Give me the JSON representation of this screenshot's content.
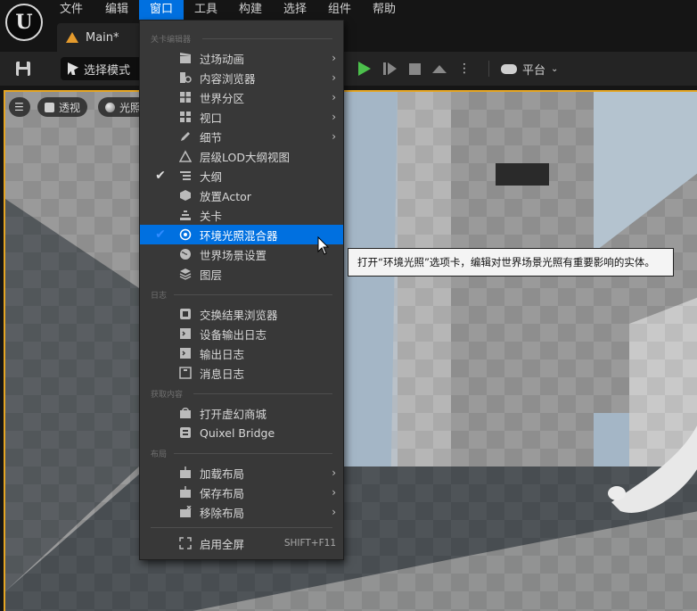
{
  "menubar": {
    "items": [
      "文件",
      "编辑",
      "窗口",
      "工具",
      "构建",
      "选择",
      "组件",
      "帮助"
    ],
    "active": "窗口"
  },
  "tab": {
    "label": "Main*"
  },
  "toolbar": {
    "mode_label": "选择模式",
    "platform_label": "平台"
  },
  "viewport": {
    "perspective_label": "透视",
    "lit_label": "光照"
  },
  "dropdown": {
    "sections": [
      {
        "label": "关卡编辑器"
      },
      {
        "label": "日志"
      },
      {
        "label": "获取内容"
      },
      {
        "label": "布局"
      }
    ],
    "items": [
      {
        "label": "过场动画",
        "submenu": true
      },
      {
        "label": "内容浏览器",
        "submenu": true
      },
      {
        "label": "世界分区",
        "submenu": true
      },
      {
        "label": "视口",
        "submenu": true
      },
      {
        "label": "细节",
        "submenu": true
      },
      {
        "label": "层级LOD大纲视图"
      },
      {
        "label": "大纲",
        "checked": true
      },
      {
        "label": "放置Actor"
      },
      {
        "label": "关卡"
      },
      {
        "label": "环境光照混合器",
        "checked": true,
        "highlighted": true
      },
      {
        "label": "世界场景设置"
      },
      {
        "label": "图层"
      },
      {
        "label": "交换结果浏览器"
      },
      {
        "label": "设备输出日志"
      },
      {
        "label": "输出日志"
      },
      {
        "label": "消息日志"
      },
      {
        "label": "打开虚幻商城"
      },
      {
        "label": "Quixel Bridge"
      },
      {
        "label": "加载布局",
        "submenu": true
      },
      {
        "label": "保存布局",
        "submenu": true
      },
      {
        "label": "移除布局",
        "submenu": true
      },
      {
        "label": "启用全屏",
        "shortcut": "SHIFT+F11"
      }
    ]
  },
  "tooltip": {
    "text": "打开“环境光照”选项卡，编辑对世界场景光照有重要影响的实体。"
  },
  "colors": {
    "accent": "#0070e0",
    "viewport_border": "#e5a523",
    "menu_bg": "#383838"
  }
}
